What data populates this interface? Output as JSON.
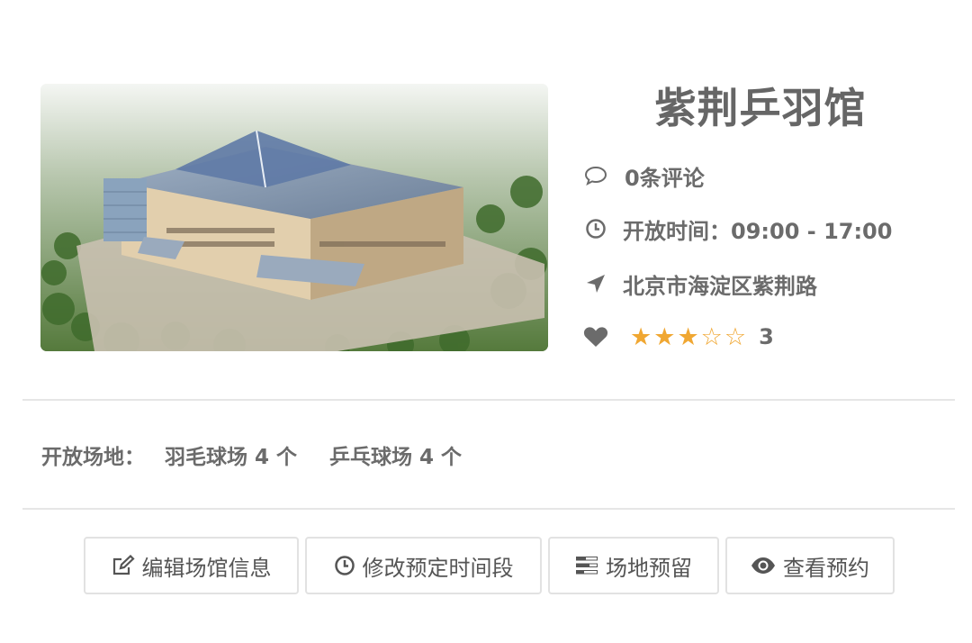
{
  "venue": {
    "title": "紫荆乒羽馆",
    "comments": "0条评论",
    "hours": "开放时间：09:00 - 17:00",
    "address": "北京市海淀区紫荆路",
    "rating": 3,
    "rating_max": 5,
    "rating_text": "3"
  },
  "courts": {
    "label": "开放场地：",
    "items": [
      "羽毛球场 4 个",
      "乒乓球场 4 个"
    ]
  },
  "actions": {
    "edit": "编辑场馆信息",
    "time": "修改预定时间段",
    "reserve": "场地预留",
    "view": "查看预约"
  },
  "colors": {
    "star": "#f0a732",
    "text": "#6b6b6b",
    "border": "#e2e2e2"
  },
  "icons": {
    "comments": "comment-bubble-icon",
    "hours": "clock-icon",
    "address": "location-arrow-icon",
    "rating": "heart-icon",
    "edit": "edit-icon",
    "time": "clock-icon",
    "reserve": "list-icon",
    "view": "eye-icon"
  }
}
